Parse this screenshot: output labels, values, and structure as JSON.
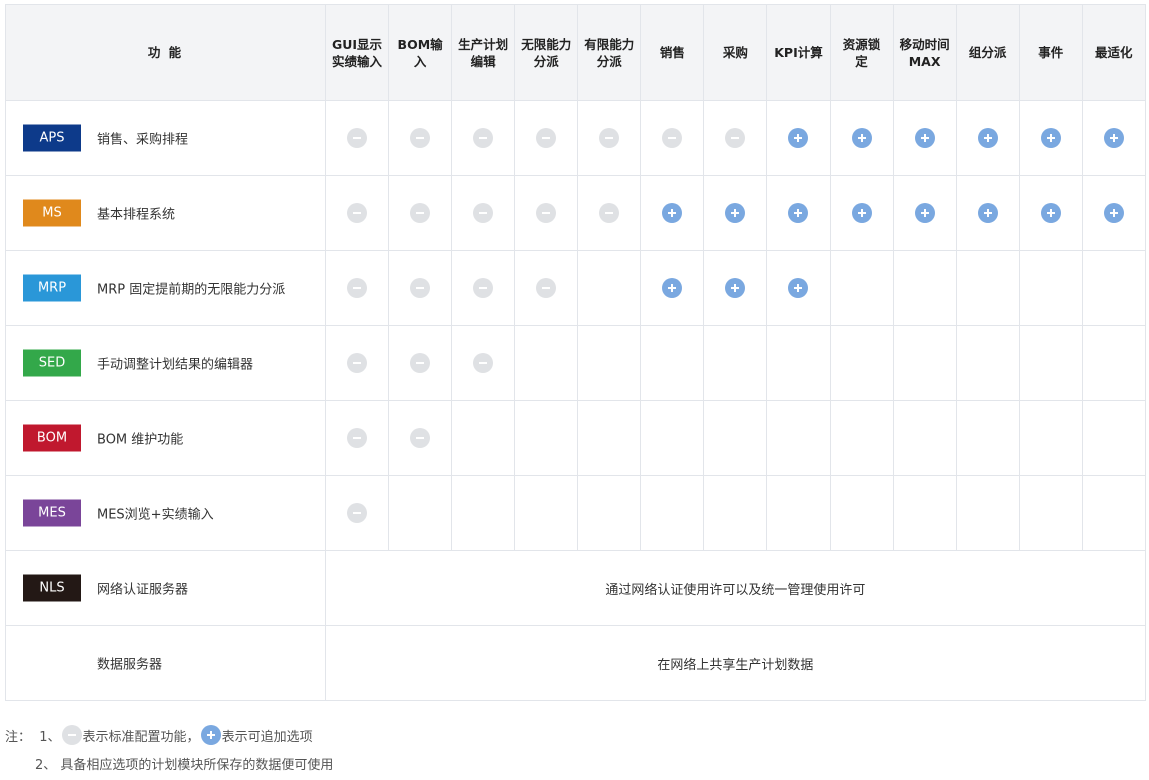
{
  "header": {
    "func_label": "功 能",
    "columns": [
      "GUI显示实绩输入",
      "BOM输入",
      "生产计划编辑",
      "无限能力分派",
      "有限能力分派",
      "销售",
      "采购",
      "KPI计算",
      "资源锁定",
      "移动时间MAX",
      "组分派",
      "事件",
      "最适化"
    ]
  },
  "legend": {
    "std": "standard",
    "opt": "optional",
    "none": "empty"
  },
  "rows": [
    {
      "code": "APS",
      "color": "#0d3a8a",
      "desc": "销售、采购排程",
      "cells": [
        "std",
        "std",
        "std",
        "std",
        "std",
        "std",
        "std",
        "opt",
        "opt",
        "opt",
        "opt",
        "opt",
        "opt"
      ]
    },
    {
      "code": "MS",
      "color": "#e0891c",
      "desc": "基本排程系统",
      "cells": [
        "std",
        "std",
        "std",
        "std",
        "std",
        "opt",
        "opt",
        "opt",
        "opt",
        "opt",
        "opt",
        "opt",
        "opt"
      ]
    },
    {
      "code": "MRP",
      "color": "#2a97d8",
      "desc": "MRP 固定提前期的无限能力分派",
      "cells": [
        "std",
        "std",
        "std",
        "std",
        "none",
        "opt",
        "opt",
        "opt",
        "none",
        "none",
        "none",
        "none",
        "none"
      ]
    },
    {
      "code": "SED",
      "color": "#33a84a",
      "desc": "手动调整计划结果的编辑器",
      "cells": [
        "std",
        "std",
        "std",
        "none",
        "none",
        "none",
        "none",
        "none",
        "none",
        "none",
        "none",
        "none",
        "none"
      ]
    },
    {
      "code": "BOM",
      "color": "#c0182e",
      "desc": "BOM 维护功能",
      "cells": [
        "std",
        "std",
        "none",
        "none",
        "none",
        "none",
        "none",
        "none",
        "none",
        "none",
        "none",
        "none",
        "none"
      ]
    },
    {
      "code": "MES",
      "color": "#7a4599",
      "desc": "MES浏览+实绩输入",
      "cells": [
        "std",
        "none",
        "none",
        "none",
        "none",
        "none",
        "none",
        "none",
        "none",
        "none",
        "none",
        "none",
        "none"
      ]
    }
  ],
  "span_rows": [
    {
      "code": "NLS",
      "color": "#231815",
      "desc": "网络认证服务器",
      "span_text": "通过网络认证使用许可以及统一管理使用许可"
    },
    {
      "code": "",
      "color": "",
      "desc": "数据服务器",
      "span_text": "在网络上共享生产计划数据"
    }
  ],
  "notes": {
    "line1_prefix": "注：  1、",
    "line1_std": "表示标准配置功能，",
    "line1_opt": "表示可追加选项",
    "line2": "2、 具备相应选项的计划模块所保存的数据便可使用"
  }
}
